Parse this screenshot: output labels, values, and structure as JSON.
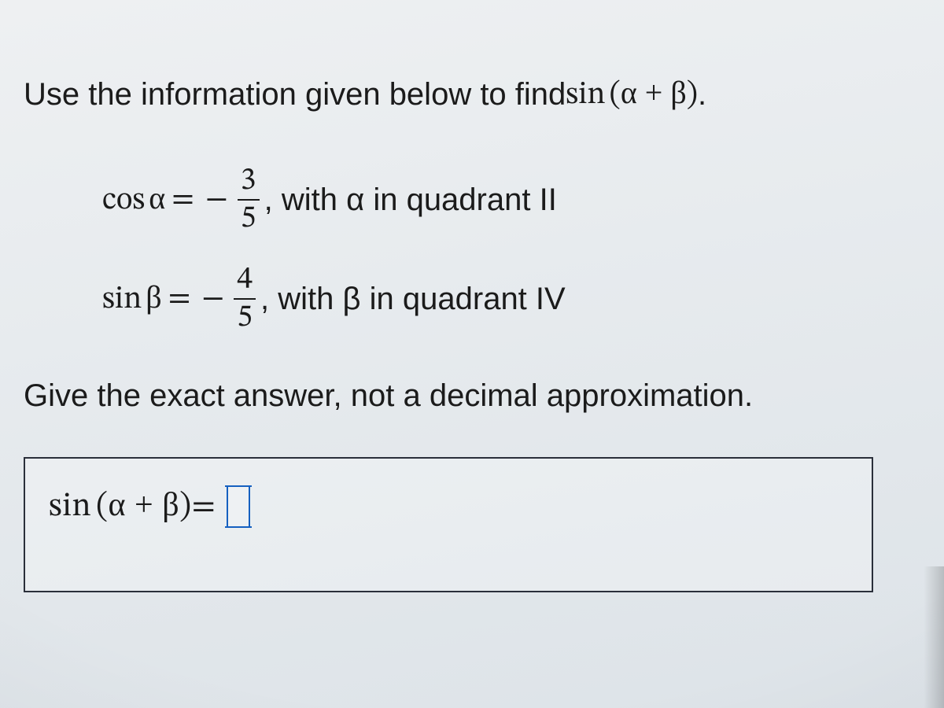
{
  "prompt": {
    "lead_text": "Use the information given below to find ",
    "target_fn": "sin",
    "target_arg_open": "(",
    "target_arg": "α + β",
    "target_arg_close": ")",
    "period": "."
  },
  "given": {
    "alpha": {
      "fn": "cos",
      "var": "α",
      "equals": "=",
      "sign": "−",
      "numerator": "3",
      "denominator": "5",
      "trail": ", with α in quadrant II"
    },
    "beta": {
      "fn": "sin",
      "var": "β",
      "equals": "=",
      "sign": "−",
      "numerator": "4",
      "denominator": "5",
      "trail": ", with β in quadrant IV"
    }
  },
  "instruction": "Give the exact answer, not a decimal approximation.",
  "answer": {
    "lhs_fn": "sin",
    "lhs_arg_open": "(",
    "lhs_arg": "α + β",
    "lhs_arg_close": ")",
    "equals": " = ",
    "input_value": ""
  }
}
